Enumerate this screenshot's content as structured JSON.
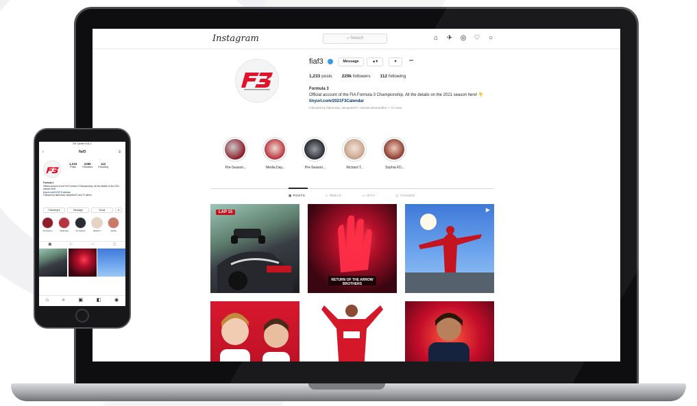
{
  "app": {
    "logo": "Instagram",
    "search_placeholder": "Search"
  },
  "nav_icons": [
    "home-icon",
    "direct-icon",
    "explore-icon",
    "activity-icon",
    "profile-icon"
  ],
  "profile": {
    "username": "fiaf3",
    "buttons": {
      "message": "Message",
      "follow": "▲▾",
      "dropdown": "▾",
      "more": "•••"
    },
    "stats": {
      "posts": "1,233",
      "posts_label": "posts",
      "followers": "229k",
      "followers_label": "followers",
      "following": "112",
      "following_label": "following"
    },
    "bio": {
      "name": "Formula 3",
      "text": "Official account of the FIA Formula 3 Championship. All the details on the 2021 season here!",
      "emoji": "👇",
      "link": "tinyurl.com/2021F3Calendar",
      "followed_by": "Followed by fiaformula, alexpeter07, romaincarlsontoffice + 71 more"
    }
  },
  "highlights": [
    {
      "label": "Pre-Season...",
      "color": "#8e1d2a"
    },
    {
      "label": "Media Day...",
      "color": "#b83340"
    },
    {
      "label": "Pre-Season...",
      "color": "#2a2c33"
    },
    {
      "label": "Richard T...",
      "color": "#e8d3c3"
    },
    {
      "label": "Sophia FD...",
      "color": "#c9786a"
    }
  ],
  "tabs": [
    {
      "label": "POSTS",
      "active": true
    },
    {
      "label": "REELS"
    },
    {
      "label": "IGTV"
    },
    {
      "label": "TAGGED"
    }
  ],
  "posts": [
    {
      "badge": "LAP 15",
      "caption": ""
    },
    {
      "badge": "",
      "caption": "RETURN OF THE ARROW BROTHERS"
    },
    {
      "badge": "",
      "caption": ""
    },
    {
      "badge": "",
      "caption": ""
    },
    {
      "badge": "",
      "caption": ""
    },
    {
      "badge": "",
      "caption": ""
    }
  ],
  "phone": {
    "status_bar": "EE Carrier 9:41 1",
    "header_title": "fiaf3",
    "stats": {
      "posts": "1,233",
      "posts_label": "Posts",
      "followers": "229k",
      "followers_label": "Followers",
      "following": "112",
      "following_label": "Following"
    },
    "bio_name": "Formula 3",
    "bio_text": "Official account of the FIA Formula 3 Championship. All the details on the 2021 season here!",
    "bio_link": "tinyurl.com/2021F3Calendar",
    "followed_by": "Followed by fiaformula, alexpeter07 and 71 others",
    "buttons": {
      "following": "Following ▾",
      "message": "Message",
      "email": "Email",
      "more": "▾"
    },
    "highlight_labels": [
      "Pre-Season...",
      "Media Day...",
      "Pre-Season...",
      "Richard T...",
      "Sophia..."
    ]
  },
  "colors": {
    "accent_blue": "#3897f0",
    "f3_red": "#e4112b",
    "text": "#262626",
    "muted": "#8e8e8e"
  }
}
